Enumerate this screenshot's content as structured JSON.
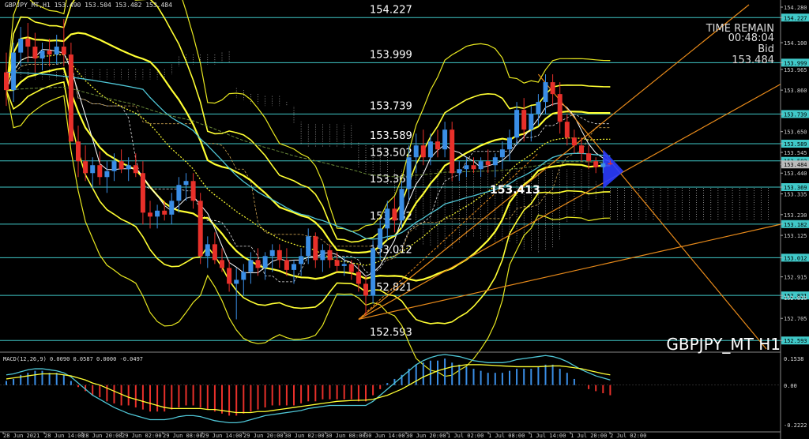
{
  "header": {
    "symbol_info": "GBPJPY_MT,H1  153.490 153.504 153.482 153.484"
  },
  "timer": {
    "label": "TIME REMAIN",
    "value": "00:48:04",
    "bid_label": "Bid",
    "bid_value": "153.484"
  },
  "watermark": "GBPJPY_MT H1",
  "macd": {
    "label": "MACD(12,26,9) 0.0090 0.0587 0.0000 -0.0497",
    "axis_top": "0.1538",
    "axis_zero": "0.00",
    "axis_bottom": "-0.2222"
  },
  "mid_label": "153.413",
  "colors": {
    "bull": "#3a8ee6",
    "bear": "#e8302a",
    "level": "#40c8c8",
    "bollinger": "#ffff33",
    "trend": "#e88a1a",
    "ma_cyan": "#4fc6d6",
    "macd_signal": "#ffff33",
    "macd_line": "#4fc6d6"
  },
  "chart_data": {
    "type": "candlestick",
    "price_axis_ticks": [
      "154.280",
      "154.227",
      "154.100",
      "153.999",
      "153.965",
      "153.860",
      "153.739",
      "153.650",
      "153.589",
      "153.545",
      "153.502",
      "153.484",
      "153.440",
      "153.369",
      "153.335",
      "153.230",
      "153.182",
      "153.125",
      "153.012",
      "152.915",
      "152.821",
      "152.810",
      "152.705",
      "152.593"
    ],
    "time_labels": [
      "28 Jun 2021",
      "28 Jun 14:00",
      "28 Jun 20:00",
      "29 Jun 02:00",
      "29 Jun 08:00",
      "29 Jun 14:00",
      "29 Jun 20:00",
      "30 Jun 02:00",
      "30 Jun 08:00",
      "30 Jun 14:00",
      "30 Jun 20:00",
      "1 Jul 02:00",
      "1 Jul 08:00",
      "1 Jul 14:00",
      "1 Jul 20:00",
      "2 Jul 02:00"
    ],
    "ylim": [
      152.55,
      154.3
    ],
    "levels": [
      154.227,
      153.999,
      153.739,
      153.589,
      153.502,
      153.369,
      153.182,
      153.012,
      152.821,
      152.593
    ],
    "level_label_values": [
      "154.227",
      "153.999",
      "153.739",
      "153.589",
      "153.502",
      "153.369",
      "153.182",
      "153.012",
      "152.821",
      "152.593"
    ],
    "candles": [
      {
        "o": 153.95,
        "h": 154.05,
        "l": 153.78,
        "c": 153.86
      },
      {
        "o": 153.86,
        "h": 154.1,
        "l": 153.8,
        "c": 154.05
      },
      {
        "o": 154.05,
        "h": 154.18,
        "l": 153.98,
        "c": 154.12
      },
      {
        "o": 154.12,
        "h": 154.2,
        "l": 154.0,
        "c": 154.08
      },
      {
        "o": 154.08,
        "h": 154.15,
        "l": 153.95,
        "c": 154.02
      },
      {
        "o": 154.02,
        "h": 154.1,
        "l": 153.96,
        "c": 154.06
      },
      {
        "o": 154.06,
        "h": 154.12,
        "l": 153.98,
        "c": 154.04
      },
      {
        "o": 154.04,
        "h": 154.14,
        "l": 153.99,
        "c": 154.08
      },
      {
        "o": 154.08,
        "h": 154.22,
        "l": 153.98,
        "c": 154.04
      },
      {
        "o": 154.04,
        "h": 154.1,
        "l": 153.8,
        "c": 153.6
      },
      {
        "o": 153.6,
        "h": 153.68,
        "l": 153.42,
        "c": 153.5
      },
      {
        "o": 153.5,
        "h": 153.58,
        "l": 153.4,
        "c": 153.44
      },
      {
        "o": 153.44,
        "h": 153.52,
        "l": 153.36,
        "c": 153.48
      },
      {
        "o": 153.48,
        "h": 153.55,
        "l": 153.38,
        "c": 153.42
      },
      {
        "o": 153.42,
        "h": 153.5,
        "l": 153.34,
        "c": 153.45
      },
      {
        "o": 153.45,
        "h": 153.54,
        "l": 153.4,
        "c": 153.5
      },
      {
        "o": 153.5,
        "h": 153.56,
        "l": 153.44,
        "c": 153.46
      },
      {
        "o": 153.46,
        "h": 153.52,
        "l": 153.4,
        "c": 153.48
      },
      {
        "o": 153.48,
        "h": 153.54,
        "l": 153.42,
        "c": 153.44
      },
      {
        "o": 153.44,
        "h": 153.5,
        "l": 153.18,
        "c": 153.24
      },
      {
        "o": 153.24,
        "h": 153.3,
        "l": 153.16,
        "c": 153.22
      },
      {
        "o": 153.22,
        "h": 153.28,
        "l": 153.16,
        "c": 153.25
      },
      {
        "o": 153.25,
        "h": 153.3,
        "l": 153.2,
        "c": 153.23
      },
      {
        "o": 153.23,
        "h": 153.34,
        "l": 153.18,
        "c": 153.3
      },
      {
        "o": 153.3,
        "h": 153.42,
        "l": 153.24,
        "c": 153.38
      },
      {
        "o": 153.38,
        "h": 153.44,
        "l": 153.3,
        "c": 153.4
      },
      {
        "o": 153.4,
        "h": 153.44,
        "l": 153.26,
        "c": 153.3
      },
      {
        "o": 153.3,
        "h": 153.34,
        "l": 152.98,
        "c": 153.02
      },
      {
        "o": 153.02,
        "h": 153.12,
        "l": 152.96,
        "c": 153.08
      },
      {
        "o": 153.08,
        "h": 153.14,
        "l": 152.98,
        "c": 153.0
      },
      {
        "o": 153.0,
        "h": 153.06,
        "l": 152.94,
        "c": 152.96
      },
      {
        "o": 152.96,
        "h": 153.0,
        "l": 152.84,
        "c": 152.88
      },
      {
        "o": 152.88,
        "h": 152.96,
        "l": 152.7,
        "c": 152.9
      },
      {
        "o": 152.9,
        "h": 152.98,
        "l": 152.82,
        "c": 152.94
      },
      {
        "o": 152.94,
        "h": 153.04,
        "l": 152.88,
        "c": 153.0
      },
      {
        "o": 153.0,
        "h": 153.06,
        "l": 152.92,
        "c": 152.96
      },
      {
        "o": 152.96,
        "h": 153.04,
        "l": 152.9,
        "c": 153.02
      },
      {
        "o": 153.02,
        "h": 153.08,
        "l": 152.94,
        "c": 153.05
      },
      {
        "o": 153.05,
        "h": 153.08,
        "l": 152.96,
        "c": 153.0
      },
      {
        "o": 153.0,
        "h": 153.06,
        "l": 152.92,
        "c": 152.95
      },
      {
        "o": 152.95,
        "h": 153.0,
        "l": 152.88,
        "c": 152.98
      },
      {
        "o": 152.98,
        "h": 153.06,
        "l": 152.92,
        "c": 153.02
      },
      {
        "o": 153.02,
        "h": 153.16,
        "l": 152.98,
        "c": 153.12
      },
      {
        "o": 153.12,
        "h": 153.14,
        "l": 152.96,
        "c": 153.0
      },
      {
        "o": 153.0,
        "h": 153.08,
        "l": 152.94,
        "c": 153.05
      },
      {
        "o": 153.05,
        "h": 153.08,
        "l": 152.96,
        "c": 153.0
      },
      {
        "o": 153.0,
        "h": 153.04,
        "l": 152.94,
        "c": 152.97
      },
      {
        "o": 152.97,
        "h": 153.02,
        "l": 152.92,
        "c": 152.98
      },
      {
        "o": 152.98,
        "h": 153.0,
        "l": 152.9,
        "c": 152.94
      },
      {
        "o": 152.94,
        "h": 152.98,
        "l": 152.84,
        "c": 152.88
      },
      {
        "o": 152.88,
        "h": 152.92,
        "l": 152.72,
        "c": 152.82
      },
      {
        "o": 152.82,
        "h": 153.1,
        "l": 152.78,
        "c": 153.06
      },
      {
        "o": 153.06,
        "h": 153.2,
        "l": 153.0,
        "c": 153.16
      },
      {
        "o": 153.16,
        "h": 153.3,
        "l": 153.1,
        "c": 153.26
      },
      {
        "o": 153.26,
        "h": 153.32,
        "l": 153.14,
        "c": 153.2
      },
      {
        "o": 153.2,
        "h": 153.4,
        "l": 153.16,
        "c": 153.36
      },
      {
        "o": 153.36,
        "h": 153.58,
        "l": 153.3,
        "c": 153.52
      },
      {
        "o": 153.52,
        "h": 153.64,
        "l": 153.44,
        "c": 153.58
      },
      {
        "o": 153.58,
        "h": 153.66,
        "l": 153.48,
        "c": 153.52
      },
      {
        "o": 153.52,
        "h": 153.64,
        "l": 153.48,
        "c": 153.6
      },
      {
        "o": 153.6,
        "h": 153.66,
        "l": 153.52,
        "c": 153.56
      },
      {
        "o": 153.56,
        "h": 153.7,
        "l": 153.52,
        "c": 153.66
      },
      {
        "o": 153.66,
        "h": 153.7,
        "l": 153.4,
        "c": 153.44
      },
      {
        "o": 153.44,
        "h": 153.5,
        "l": 153.4,
        "c": 153.46
      },
      {
        "o": 153.46,
        "h": 153.52,
        "l": 153.42,
        "c": 153.48
      },
      {
        "o": 153.48,
        "h": 153.52,
        "l": 153.44,
        "c": 153.46
      },
      {
        "o": 153.46,
        "h": 153.52,
        "l": 153.42,
        "c": 153.5
      },
      {
        "o": 153.5,
        "h": 153.56,
        "l": 153.44,
        "c": 153.48
      },
      {
        "o": 153.48,
        "h": 153.54,
        "l": 153.42,
        "c": 153.52
      },
      {
        "o": 153.52,
        "h": 153.6,
        "l": 153.46,
        "c": 153.56
      },
      {
        "o": 153.56,
        "h": 153.66,
        "l": 153.5,
        "c": 153.62
      },
      {
        "o": 153.62,
        "h": 153.8,
        "l": 153.58,
        "c": 153.76
      },
      {
        "o": 153.76,
        "h": 153.82,
        "l": 153.6,
        "c": 153.66
      },
      {
        "o": 153.66,
        "h": 153.78,
        "l": 153.6,
        "c": 153.74
      },
      {
        "o": 153.74,
        "h": 153.84,
        "l": 153.68,
        "c": 153.8
      },
      {
        "o": 153.8,
        "h": 153.94,
        "l": 153.74,
        "c": 153.9
      },
      {
        "o": 153.9,
        "h": 153.94,
        "l": 153.78,
        "c": 153.84
      },
      {
        "o": 153.84,
        "h": 153.9,
        "l": 153.64,
        "c": 153.7
      },
      {
        "o": 153.7,
        "h": 153.74,
        "l": 153.58,
        "c": 153.62
      },
      {
        "o": 153.62,
        "h": 153.66,
        "l": 153.54,
        "c": 153.58
      },
      {
        "o": 153.58,
        "h": 153.62,
        "l": 153.5,
        "c": 153.54
      },
      {
        "o": 153.54,
        "h": 153.58,
        "l": 153.46,
        "c": 153.5
      },
      {
        "o": 153.5,
        "h": 153.52,
        "l": 153.44,
        "c": 153.47
      },
      {
        "o": 153.47,
        "h": 153.51,
        "l": 153.44,
        "c": 153.49
      },
      {
        "o": 153.49,
        "h": 153.504,
        "l": 153.482,
        "c": 153.484
      }
    ],
    "macd_hist": [
      0.02,
      0.03,
      0.05,
      0.06,
      0.07,
      0.07,
      0.06,
      0.06,
      0.05,
      0.02,
      -0.01,
      -0.03,
      -0.05,
      -0.06,
      -0.08,
      -0.09,
      -0.1,
      -0.1,
      -0.11,
      -0.12,
      -0.13,
      -0.13,
      -0.13,
      -0.12,
      -0.11,
      -0.1,
      -0.1,
      -0.11,
      -0.12,
      -0.13,
      -0.14,
      -0.15,
      -0.15,
      -0.14,
      -0.13,
      -0.12,
      -0.11,
      -0.1,
      -0.1,
      -0.1,
      -0.1,
      -0.09,
      -0.08,
      -0.08,
      -0.07,
      -0.07,
      -0.07,
      -0.07,
      -0.07,
      -0.08,
      -0.08,
      -0.05,
      -0.02,
      0.01,
      0.03,
      0.05,
      0.08,
      0.1,
      0.11,
      0.12,
      0.12,
      0.13,
      0.11,
      0.1,
      0.09,
      0.08,
      0.07,
      0.06,
      0.06,
      0.06,
      0.07,
      0.08,
      0.08,
      0.08,
      0.09,
      0.1,
      0.1,
      0.08,
      0.06,
      0.03,
      0.0,
      -0.02,
      -0.03,
      -0.04,
      -0.05
    ],
    "macd_signal": [
      0.03,
      0.035,
      0.04,
      0.045,
      0.05,
      0.055,
      0.055,
      0.055,
      0.05,
      0.045,
      0.035,
      0.025,
      0.01,
      0.0,
      -0.015,
      -0.03,
      -0.045,
      -0.06,
      -0.07,
      -0.08,
      -0.09,
      -0.1,
      -0.11,
      -0.115,
      -0.115,
      -0.115,
      -0.115,
      -0.115,
      -0.12,
      -0.12,
      -0.125,
      -0.13,
      -0.135,
      -0.135,
      -0.135,
      -0.13,
      -0.13,
      -0.125,
      -0.12,
      -0.115,
      -0.11,
      -0.105,
      -0.1,
      -0.095,
      -0.09,
      -0.085,
      -0.08,
      -0.078,
      -0.076,
      -0.075,
      -0.074,
      -0.07,
      -0.06,
      -0.05,
      -0.035,
      -0.02,
      0.0,
      0.02,
      0.04,
      0.055,
      0.07,
      0.08,
      0.09,
      0.095,
      0.1,
      0.1,
      0.1,
      0.098,
      0.096,
      0.094,
      0.092,
      0.09,
      0.09,
      0.09,
      0.09,
      0.092,
      0.094,
      0.094,
      0.09,
      0.085,
      0.08,
      0.072,
      0.064,
      0.056,
      0.05
    ],
    "macd_line": [
      0.05,
      0.055,
      0.065,
      0.075,
      0.08,
      0.08,
      0.075,
      0.07,
      0.06,
      0.04,
      0.01,
      -0.02,
      -0.05,
      -0.07,
      -0.09,
      -0.11,
      -0.125,
      -0.14,
      -0.15,
      -0.16,
      -0.17,
      -0.17,
      -0.17,
      -0.165,
      -0.155,
      -0.15,
      -0.15,
      -0.155,
      -0.165,
      -0.175,
      -0.18,
      -0.185,
      -0.185,
      -0.18,
      -0.17,
      -0.16,
      -0.15,
      -0.145,
      -0.14,
      -0.135,
      -0.13,
      -0.125,
      -0.115,
      -0.11,
      -0.105,
      -0.1,
      -0.1,
      -0.1,
      -0.1,
      -0.1,
      -0.1,
      -0.08,
      -0.05,
      -0.02,
      0.01,
      0.04,
      0.07,
      0.1,
      0.12,
      0.135,
      0.145,
      0.15,
      0.145,
      0.14,
      0.13,
      0.12,
      0.115,
      0.11,
      0.11,
      0.11,
      0.115,
      0.125,
      0.13,
      0.135,
      0.14,
      0.145,
      0.14,
      0.13,
      0.115,
      0.095,
      0.075,
      0.06,
      0.045,
      0.035,
      0.025
    ],
    "macd_ylim": [
      -0.2222,
      0.1538
    ]
  }
}
